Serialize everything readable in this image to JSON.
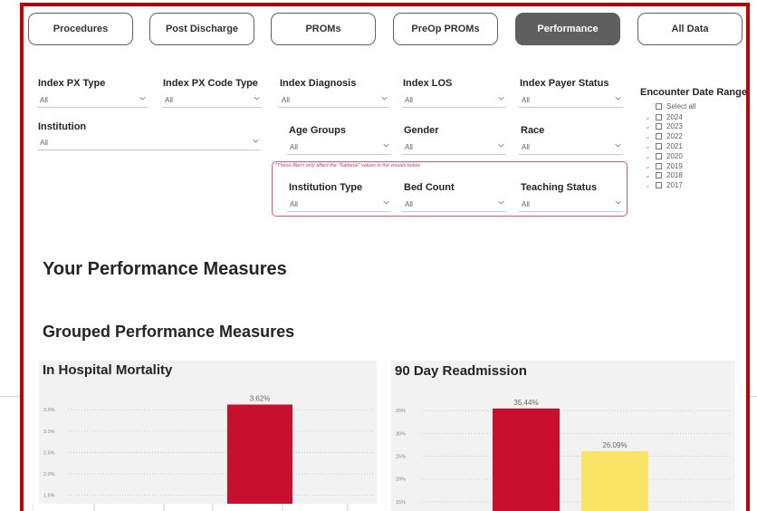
{
  "tabs": [
    {
      "label": "Procedures",
      "active": false
    },
    {
      "label": "Post Discharge",
      "active": false
    },
    {
      "label": "PROMs",
      "active": false
    },
    {
      "label": "PreOp PROMs",
      "active": false
    },
    {
      "label": "Performance",
      "active": true
    },
    {
      "label": "All Data",
      "active": false
    }
  ],
  "filters": {
    "index_px_type": {
      "label": "Index PX Type",
      "value": "All"
    },
    "index_px_code_type": {
      "label": "Index PX Code Type",
      "value": "All"
    },
    "index_diagnosis": {
      "label": "Index Diagnosis",
      "value": "All"
    },
    "index_los": {
      "label": "Index LOS",
      "value": "All"
    },
    "index_payer_status": {
      "label": "Index Payer Status",
      "value": "All"
    },
    "institution": {
      "label": "Institution",
      "value": "All"
    },
    "age_groups": {
      "label": "Age Groups",
      "value": "All"
    },
    "gender": {
      "label": "Gender",
      "value": "All"
    },
    "race": {
      "label": "Race",
      "value": "All"
    },
    "institution_type": {
      "label": "Institution Type",
      "value": "All"
    },
    "bed_count": {
      "label": "Bed Count",
      "value": "All"
    },
    "teaching_status": {
      "label": "Teaching Status",
      "value": "All"
    }
  },
  "national_note": "*These filters only affect the \"National\" values in the visuals below",
  "encounter_date_range": {
    "title": "Encounter Date Range",
    "select_all": "Select all",
    "years": [
      "2024",
      "2023",
      "2022",
      "2021",
      "2020",
      "2019",
      "2018",
      "2017"
    ]
  },
  "headings": {
    "your_performance": "Your Performance Measures",
    "grouped_performance": "Grouped Performance Measures"
  },
  "colors": {
    "red": "#c8102e",
    "yellow": "#f9e465",
    "frame": "#c00000",
    "active_tab": "#5f5f5f"
  },
  "chart_data": [
    {
      "type": "bar",
      "title": "In Hospital Mortality",
      "y_ticks": [
        "3.5%",
        "3.0%",
        "2.5%",
        "2.0%",
        "1.5%"
      ],
      "ylim": [
        1.3,
        3.8
      ],
      "bars": [
        {
          "value": 3.62,
          "label": "3.62%",
          "color": "#c8102e"
        }
      ]
    },
    {
      "type": "bar",
      "title": "90 Day Readmission",
      "y_ticks": [
        "35%",
        "30%",
        "25%",
        "20%",
        "15%"
      ],
      "ylim": [
        13,
        38
      ],
      "bars": [
        {
          "value": 35.44,
          "label": "35.44%",
          "color": "#c8102e"
        },
        {
          "value": 26.09,
          "label": "26.09%",
          "color": "#f9e465"
        }
      ]
    }
  ]
}
